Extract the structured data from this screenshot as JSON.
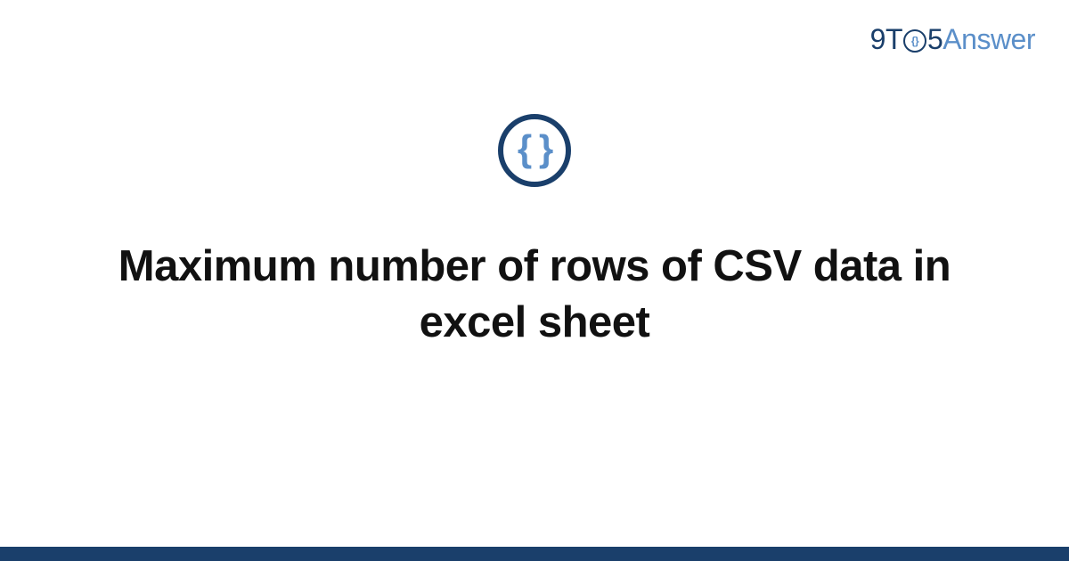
{
  "brand": {
    "part1": "9T",
    "o_inner": "{}",
    "part2": "5",
    "part3": "Answer"
  },
  "topic_icon_glyph": "{ }",
  "title": "Maximum number of rows of CSV data in excel sheet"
}
